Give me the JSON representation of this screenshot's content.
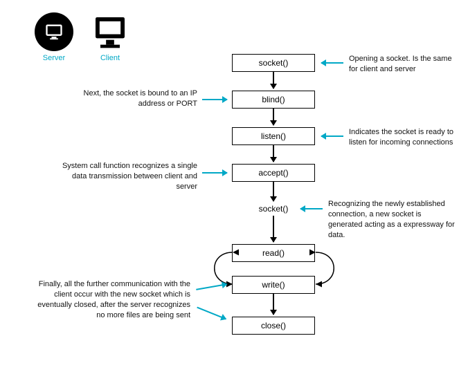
{
  "legend": {
    "server": "Server",
    "client": "Client"
  },
  "flow": {
    "socket": "socket()",
    "blind": "blind()",
    "listen": "listen()",
    "accept": "accept()",
    "socket2": "socket()",
    "read": "read()",
    "write": "write()",
    "close": "close()"
  },
  "notes": {
    "socket": "Opening a socket. Is the same for client and server",
    "blind": "Next, the socket is bound to an IP address or PORT",
    "listen": "Indicates the socket is ready to listen for incoming connections",
    "accept": "System call function recognizes a single data transmission between client and server",
    "socket2": "Recognizing the newly established connection, a new socket is generated acting as a expressway for data.",
    "close": "Finally, all the further communication with the client occur with the new socket which is eventually closed, after the server recognizes no more files are being sent"
  }
}
